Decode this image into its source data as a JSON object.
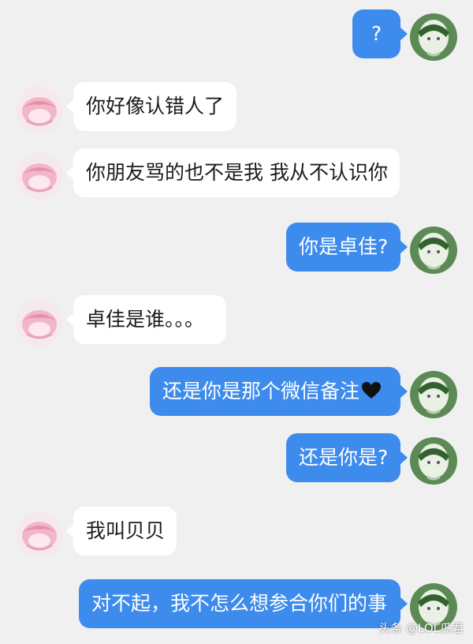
{
  "conversation": {
    "messages": [
      {
        "side": "right",
        "text": "?"
      },
      {
        "side": "left",
        "text": "你好像认错人了"
      },
      {
        "side": "left",
        "text": "你朋友骂的也不是我 我从不认识你"
      },
      {
        "side": "right",
        "text": "你是卓佳?"
      },
      {
        "side": "left",
        "text": "卓佳是谁。。。"
      },
      {
        "side": "right",
        "text": "还是你是那个微信备注",
        "emoji": "black-heart-icon"
      },
      {
        "side": "right",
        "text": "还是你是?"
      },
      {
        "side": "left",
        "text": "我叫贝贝"
      },
      {
        "side": "right",
        "text": "对不起，我不怎么想参合你们的事"
      }
    ]
  },
  "avatars": {
    "self": "green-anime-avatar",
    "other": "pink-anime-avatar"
  },
  "colors": {
    "background": "#f0f0f0",
    "outgoing_bubble": "#3d8bec",
    "incoming_bubble": "#ffffff"
  },
  "watermark": {
    "text": "头条 @LOL瓜君"
  }
}
